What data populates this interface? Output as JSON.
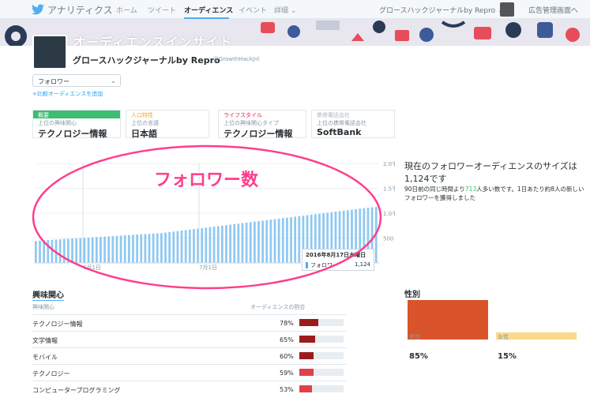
{
  "topnav": {
    "brand": "アナリティクス",
    "items": [
      "ホーム",
      "ツイート",
      "オーディエンス",
      "イベント",
      "詳細 ⌄"
    ],
    "account": "グロースハックジャーナルby Repro ⌄",
    "ads": "広告管理画面へ"
  },
  "banner": {
    "title": "オーディエンスインサイト"
  },
  "profile": {
    "name": "グロースハックジャーナルby Repro",
    "handle": "@GrowthHackJnl"
  },
  "dropdown": {
    "value": "フォロワー",
    "caret": "⌄"
  },
  "add_compare": "+比較オーディエンスを追加",
  "tabs": [
    {
      "category": "概要",
      "sub": "上位の興味関心",
      "value": "テクノロジー情報",
      "color": "#3cbd70"
    },
    {
      "category": "人口特性",
      "sub": "上位の言語",
      "value": "日本語",
      "color": "#f5a623"
    },
    {
      "category": "ライフスタイル",
      "sub": "上位の興味関心タイプ",
      "value": "テクノロジー情報",
      "color": "#e0245e"
    },
    {
      "category": "携帯電話会社",
      "sub": "上位の携帯電話会社",
      "value": "SoftBank",
      "color": "#aab8c2"
    }
  ],
  "chart_data": {
    "type": "bar",
    "title": "",
    "xlabel": "",
    "ylabel": "",
    "ylim": [
      0,
      2000
    ],
    "yticks": [
      "2.0千",
      "1.5千",
      "1.0千",
      "500"
    ],
    "xticks": [
      "6月1日",
      "7月1日"
    ],
    "series": [
      {
        "values": [
          440,
          450,
          455,
          460,
          465,
          470,
          475,
          480,
          485,
          490,
          495,
          500,
          505,
          510,
          515,
          520,
          525,
          530,
          535,
          540,
          545,
          550,
          555,
          560,
          565,
          570,
          575,
          580,
          585,
          590,
          595,
          600,
          610,
          620,
          630,
          640,
          650,
          660,
          670,
          680,
          690,
          700,
          710,
          720,
          730,
          740,
          750,
          760,
          770,
          780,
          790,
          800,
          810,
          820,
          830,
          840,
          850,
          860,
          870,
          880,
          890,
          900,
          910,
          920,
          930,
          940,
          950,
          960,
          970,
          980,
          990,
          1000,
          1010,
          1020,
          1030,
          1040,
          1050,
          1060,
          1070,
          1080,
          1090,
          1100,
          1110,
          1120,
          1124
        ]
      }
    ],
    "color": "#8fc8f2",
    "tooltip": {
      "date": "2016年8月17日水曜日",
      "series": "フォロワー",
      "value": "1,124"
    },
    "annotation": "フォロワー数"
  },
  "summary": {
    "title": "現在のフォロワーオーディエンスのサイズは1,124です",
    "detail_pre": "90日前の同じ時間より",
    "detail_num": "713",
    "detail_post": "人多い数です。1日あたり約8人の新しいフォロワーを獲得しました"
  },
  "interests": {
    "section_title": "興味関心",
    "col_label": "興味関心",
    "col_share": "オーディエンスの割合",
    "rows": [
      {
        "label": "テクノロジー情報",
        "pct": "78%",
        "value": 78,
        "color": "#9b1c1c"
      },
      {
        "label": "文学情報",
        "pct": "65%",
        "value": 65,
        "color": "#9b1c1c"
      },
      {
        "label": "モバイル",
        "pct": "60%",
        "value": 60,
        "color": "#9b1c1c"
      },
      {
        "label": "テクノロジー",
        "pct": "59%",
        "value": 59,
        "color": "#e0404a"
      },
      {
        "label": "コンピュータープログラミング",
        "pct": "53%",
        "value": 53,
        "color": "#e0404a"
      }
    ]
  },
  "gender": {
    "title": "性別",
    "male_label": "男性",
    "male_pct": "85%",
    "male_value": 85,
    "male_color": "#d9542b",
    "female_label": "女性",
    "female_pct": "15%",
    "female_value": 15,
    "female_color": "#f9d98c"
  }
}
